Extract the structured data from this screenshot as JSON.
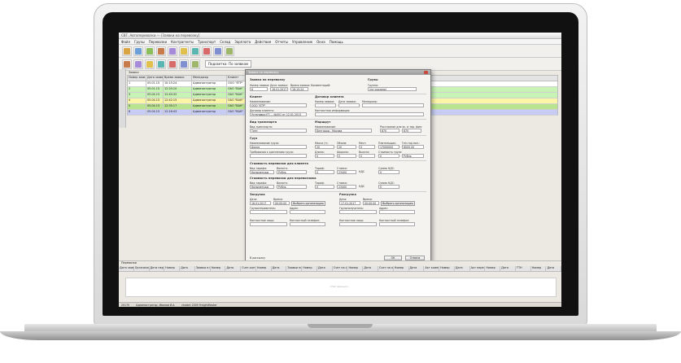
{
  "window": {
    "title": "СВТ. Автоперевозки — [Заявки на перевозку]"
  },
  "menu": [
    "Файл",
    "Грузы",
    "Перевозки",
    "Контрагенты",
    "Транспорт",
    "Склад",
    "Зарплата",
    "Действия",
    "Отчеты",
    "Управление",
    "Окна",
    "Помощь"
  ],
  "toolbar": {
    "icons": [
      "open-icon",
      "save-icon",
      "print-icon",
      "truck-icon",
      "contract-icon",
      "report-icon",
      "settings-icon",
      "users-icon",
      "map-icon",
      "chart-icon"
    ],
    "sub_icons": [
      "new-icon",
      "edit-icon",
      "copy-icon",
      "delete-icon",
      "refresh-icon",
      "filter-icon",
      "export-icon"
    ],
    "group_label": "Подсветка: По заявкам"
  },
  "main_table": {
    "caption": "Заявки",
    "columns": [
      "Номер заяв",
      "Дата заявки",
      "Время заявки",
      "Менеджер",
      "Клиент",
      "Н.",
      "Дата прибытия",
      "Растояние по нар.",
      "Расст. для начи",
      "Расст. для марш",
      "Вид транс. средства"
    ],
    "rows": [
      {
        "num": "1",
        "date": "05.01.15",
        "time": "10:15:24",
        "manager": "Администратор",
        "client": "ООО \"ЕТР\"",
        "extra": "Москва",
        "dist": "0,0",
        "d2": "0,0",
        "d3": "0,0",
        "type": "Тент",
        "color": "#ffffff"
      },
      {
        "num": "2",
        "date": "05.01.15",
        "time": "12:20:10",
        "manager": "Администратор",
        "client": "ОАО \"ВАК\"",
        "extra": "Москва",
        "dist": "0,0",
        "d2": "0,0",
        "d3": "0,0",
        "type": "Открытый",
        "color": "#c7f3b5"
      },
      {
        "num": "3",
        "date": "05.04.15",
        "time": "12:40:32",
        "manager": "Администратор",
        "client": "ОАО \"ВАК\"",
        "extra": "Петербург",
        "dist": "0,0",
        "d2": "0,0",
        "d3": "0,0",
        "type": "Тент",
        "color": "#c7f3b5"
      },
      {
        "num": "4",
        "date": "05.04.15",
        "time": "12:42:15",
        "manager": "Администратор",
        "client": "ОАО \"ВАК\"",
        "extra": "Москва",
        "dist": "140",
        "d2": "7,0",
        "d3": "0,0",
        "type": "Рефрижератор",
        "color": "#fbf6a6"
      },
      {
        "num": "5",
        "date": "05.04.15",
        "time": "12:35:17",
        "manager": "Администратор",
        "client": "ОАО \"ВАК\"",
        "extra": "Москва",
        "dist": "0,0",
        "d2": "0,0",
        "d3": "0,0",
        "type": "Рефрижератор",
        "color": "#b9e48f"
      },
      {
        "num": "6",
        "date": "05.04.15",
        "time": "12:16:43",
        "manager": "Администратор",
        "client": "ОАО \"ВАК\"",
        "extra": "Москва",
        "dist": "70",
        "d2": "7,0",
        "d3": "0,0",
        "type": "Рефрижератор",
        "color": "#c6ccf3"
      }
    ]
  },
  "dialog": {
    "title": "Заявка на перевозку",
    "sec_order": "Заявка на перевозку",
    "lbl_order_num": "Номер заявки:",
    "order_num": "6",
    "lbl_order_date": "Дата заявки:",
    "order_date": "16.01.2017",
    "lbl_order_time": "Время заявки:",
    "order_time": "16:15:24",
    "lbl_comment": "Комментарий:",
    "sec_cargo_owner": "Грузы",
    "lbl_group": "Группа:",
    "group": "(не указано)",
    "sec_client": "Клиент",
    "lbl_name": "Наименование:",
    "client_name": "ООО \"ЕТР\"",
    "lbl_contract": "Договор клиента",
    "lbl_client_contract": "Договор клиента:",
    "client_contract": "Установки ЕТ-... №001 от 12.01.2013",
    "lbl_contract_num": "Номер заявки:",
    "lbl_contract_date": "Дата заявки:",
    "lbl_manager": "Менеджер:",
    "lbl_contact": "Контактная информация:",
    "sec_transport": "Вид транспорта",
    "lbl_transport_type": "Вид транспорта:",
    "transport_type": "Тент",
    "sec_route": "Маршрут",
    "lbl_route_name": "Наименование:",
    "route_name": "Белгород - Москва",
    "lbl_distance": "Расстояние для эк. и тар. фин:",
    "distance": "870",
    "distance2": "870",
    "sec_cargo": "Груз",
    "lbl_cargo_name": "Наименование груза:",
    "cargo_name": "Доска",
    "lbl_mass": "Масса (т):",
    "mass": "20",
    "lbl_volume": "Объем:",
    "volume": "20",
    "lbl_places": "Мест:",
    "places": "0",
    "lbl_payer": "Плательщик:",
    "payer": "17000000",
    "lbl_cost": "Ген.тар.нал.:",
    "cost": "8000,00",
    "lbl_packing": "Требования к креплению груза:",
    "lbl_length": "Длина:",
    "length": "0",
    "lbl_width": "Ширина:",
    "width": "0",
    "lbl_height": "Высота:",
    "height": "0",
    "lbl_insurance": "Стоимость груза:",
    "insurance": "0",
    "insurance_cur": "Рубль",
    "sec_client_cost": "Стоимость перевозки для клиента",
    "lbl_tariff_type": "Вид тарифа:",
    "tariff_type": "Километраж",
    "lbl_currency": "Валюта:",
    "currency": "Рубль",
    "lbl_tariff": "Тариф:",
    "tariff": "0",
    "lbl_rate": "Ставка:",
    "rate": "23400",
    "lbl_nds": "НДС",
    "lbl_nds_sum": "Сумма НДС:",
    "nds_sum": "0",
    "sec_carrier_cost": "Стоимость перевозки для перевозчика",
    "tariff_type2": "Километраж",
    "currency2": "Рубль",
    "tariff2": "0",
    "rate2": "23400",
    "nds_sum2": "0",
    "sec_loading": "Загрузка",
    "lbl_date": "Дата:",
    "loading_date": "16.01.2017",
    "lbl_time": "Время:",
    "loading_time": "00:00:00",
    "choose_org": "Выбрать организацию",
    "lbl_shipper": "Грузоотправитель:",
    "lbl_address": "Адрес:",
    "lbl_contact_person": "Контактное лицо:",
    "lbl_phone": "Контактный телефон:",
    "sec_unloading": "Разгрузка",
    "unloading_date": "17.01.2017",
    "unloading_time": "00:00:00",
    "choose_org2": "Выбрать организацию",
    "lbl_consignee": "Грузополучатель:",
    "lbl_address2": "Адрес:",
    "lbl_contact_person2": "Контактное лицо:",
    "lbl_phone2": "Контактный телефон:",
    "chk_print": "В рассылку",
    "ok": "ОК",
    "cancel": "Отмена"
  },
  "bottom": {
    "caption": "Перевозки",
    "columns": [
      "Дата заявки",
      "Организация",
      "Дата перевозки",
      "Номер",
      "Дата",
      "Заявка в клиента",
      "Номер",
      "Дата",
      "Счет-контур клиента",
      "Номер",
      "Дата",
      "Заявки перевозчика",
      "Номер",
      "Дата",
      "Счет на оплату клиента",
      "Номер",
      "Дата",
      "Счет на оплату перевозчика",
      "Номер",
      "Дата",
      "Акт клиента",
      "Номер",
      "Дата",
      "Акт перевозчика",
      "Номер",
      "Дата",
      "ТТН",
      "Номер",
      "Дата"
    ],
    "empty": "<Нет данных>"
  },
  "status": {
    "left": "20170",
    "user": "Администратор, Иванов И.А.",
    "version": "ntalent 2009 FreightMaster"
  }
}
